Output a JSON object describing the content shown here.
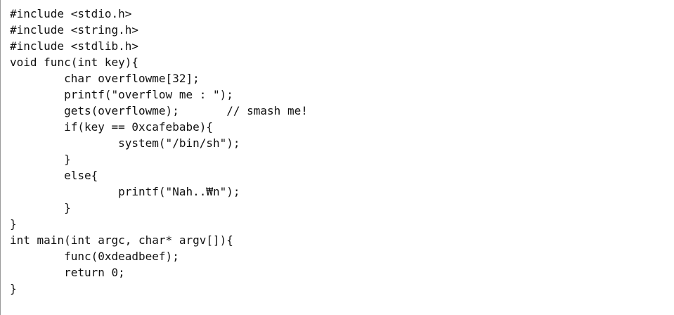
{
  "editor": {
    "lines": [
      "#include <stdio.h>",
      "#include <string.h>",
      "#include <stdlib.h>",
      "void func(int key){",
      "        char overflowme[32];",
      "        printf(\"overflow me : \");",
      "        gets(overflowme);       // smash me!",
      "        if(key == 0xcafebabe){",
      "                system(\"/bin/sh\");",
      "        }",
      "        else{",
      "                printf(\"Nah..₩n\");",
      "        }",
      "}",
      "int main(int argc, char* argv[]){",
      "        func(0xdeadbeef);",
      "        return 0;",
      "}"
    ]
  }
}
